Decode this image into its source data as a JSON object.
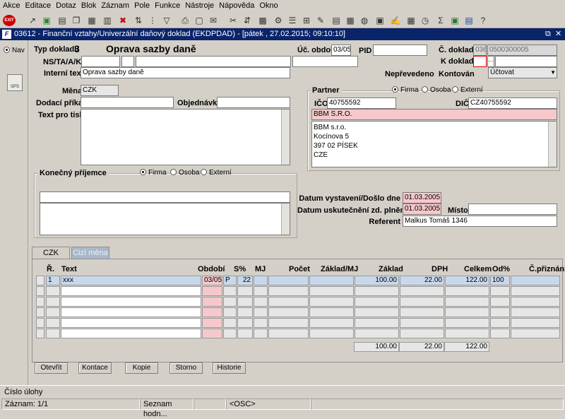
{
  "menu": [
    "Akce",
    "Editace",
    "Dotaz",
    "Blok",
    "Záznam",
    "Pole",
    "Funkce",
    "Nástroje",
    "Nápověda",
    "Okno"
  ],
  "toolbar_exit": "EXIT",
  "window_title": "03612 - Finanční vztahy/Univerzální daňový doklad (EKDPDAD) - [pátek , 27.02.2015; 09:10:10]",
  "window_controls": [
    "⧉",
    "✕"
  ],
  "nav": {
    "label": "Nav",
    "sps": "SPS"
  },
  "header": {
    "typ_dokladu_label": "Typ dokladu",
    "typ_dokladu_value": "3",
    "typ_dokladu_name": "Oprava sazby daně",
    "uc_obdobi_label": "Úč. období",
    "uc_obdobi_value": "03/05",
    "pid_label": "PID",
    "pid_value": "",
    "c_dokladu_label": "Č. dokladu",
    "c_dokladu_prefix": "036",
    "c_dokladu_value": "0500300005",
    "ns_label": "NS/TA/A/KP",
    "k_dokladu_label": "K dokladu",
    "k_dokladu_btn": "···",
    "interni_text_label": "Interní text",
    "interni_text_value": "Oprava sazby daně",
    "neprevedeno": "Nepřevedeno",
    "kontovan_label": "Kontován",
    "kontovan_value": "Účtovat"
  },
  "left": {
    "mena_label": "Měna",
    "mena_value": "CZK",
    "dodaci_label": "Dodací příkaz",
    "objednavka_label": "Objednávka",
    "text_pro_tisk_label": "Text pro tisk",
    "konecny_prijemce_label": "Konečný příjemce",
    "radio_firma": "Firma",
    "radio_osoba": "Osoba",
    "radio_externi": "Externí"
  },
  "partner": {
    "label": "Partner",
    "radio_firma": "Firma",
    "radio_osoba": "Osoba",
    "radio_externi": "Externí",
    "ico_label": "IČO",
    "ico_value": "40755592",
    "dic_label": "DIČ",
    "dic_value": "CZ40755592",
    "name": "BBM S.R.O.",
    "address": [
      "BBM s.r.o.",
      "Kocínova 5",
      "397 02 PÍSEK",
      "CZE"
    ]
  },
  "dates": {
    "vystaveni_label": "Datum vystavení/Došlo dne",
    "vystaveni_value": "01.03.2005",
    "uskutecneni_label": "Datum uskutečnění zd. plnění",
    "uskutecneni_value": "01.03.2005",
    "misto_label": "Místo",
    "misto_value": "",
    "referent_label": "Referent",
    "referent_value": "Malkus Tomáš 1346"
  },
  "tabs": [
    {
      "label": "CZK",
      "active": true
    },
    {
      "label": "Cizí měna",
      "active": false
    }
  ],
  "grid": {
    "headers": {
      "r": "Ř.",
      "text": "Text",
      "obdobi": "Období",
      "s": "S%",
      "mj": "MJ",
      "pocet": "Počet",
      "zakladmj": "Základ/MJ",
      "zaklad": "Základ",
      "dph": "DPH",
      "celkem": "Celkem",
      "od": "Od%",
      "cprizn": "Č.přiznání"
    },
    "rows": [
      {
        "r": "1",
        "text": "xxx",
        "obdobi": "03/05",
        "s": "P",
        "sv": "22",
        "mj": "",
        "pocet": "",
        "zakladmj": "",
        "zaklad": "100.00",
        "dph": "22.00",
        "celkem": "122.00",
        "od": "100",
        "cprizn": ""
      }
    ],
    "totals": {
      "zaklad": "100.00",
      "dph": "22.00",
      "celkem": "122.00"
    }
  },
  "buttons": [
    "Otevřít",
    "Kontace",
    "Kopie",
    "Storno",
    "Historie"
  ],
  "status": {
    "line1": "Číslo úlohy",
    "zaznam": "Záznam: 1/1",
    "seznam": "Seznam hodn...",
    "osc": "<OSC>"
  }
}
